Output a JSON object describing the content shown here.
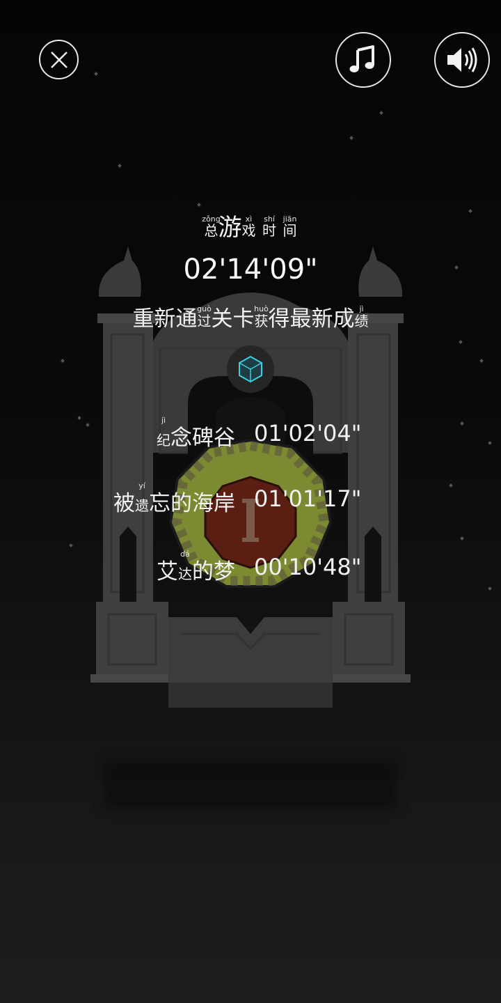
{
  "header": {
    "close_icon": "close-icon",
    "music_icon": "music-note-icon",
    "sound_icon": "speaker-icon"
  },
  "title": {
    "chars": [
      {
        "hz": "总",
        "py": "zǒng"
      },
      {
        "hz": "游",
        "py": ""
      },
      {
        "hz": "戏",
        "py": "xì"
      },
      {
        "hz": "时",
        "py": "shí"
      },
      {
        "hz": "间",
        "py": "jiān"
      }
    ]
  },
  "total_time": "02'14'09\"",
  "replay_note": {
    "parts": [
      {
        "hz": "重新通",
        "py": ""
      },
      {
        "hz": "过",
        "py": "guò"
      },
      {
        "hz": "关卡",
        "py": ""
      },
      {
        "hz": "获",
        "py": "huò"
      },
      {
        "hz": "得最新成",
        "py": ""
      },
      {
        "hz": "绩",
        "py": "jì"
      }
    ]
  },
  "levels": [
    {
      "name_parts": [
        {
          "hz": "纪",
          "py": "jì"
        },
        {
          "hz": "念碑谷",
          "py": ""
        }
      ],
      "time": "01'02'04\""
    },
    {
      "name_parts": [
        {
          "hz": "被",
          "py": ""
        },
        {
          "hz": "遗",
          "py": "yí"
        },
        {
          "hz": "忘的海岸",
          "py": ""
        }
      ],
      "time": "01'01'17\""
    },
    {
      "name_parts": [
        {
          "hz": "艾",
          "py": ""
        },
        {
          "hz": "达",
          "py": "dá"
        },
        {
          "hz": "的梦",
          "py": ""
        }
      ],
      "time": "00'10'48\""
    }
  ],
  "colors": {
    "background": "#0a0a0a",
    "stone": "#3a3a3a",
    "gem": "#3ad0e0",
    "island_grass": "#7c8a32",
    "island_center": "#5a1e12"
  }
}
